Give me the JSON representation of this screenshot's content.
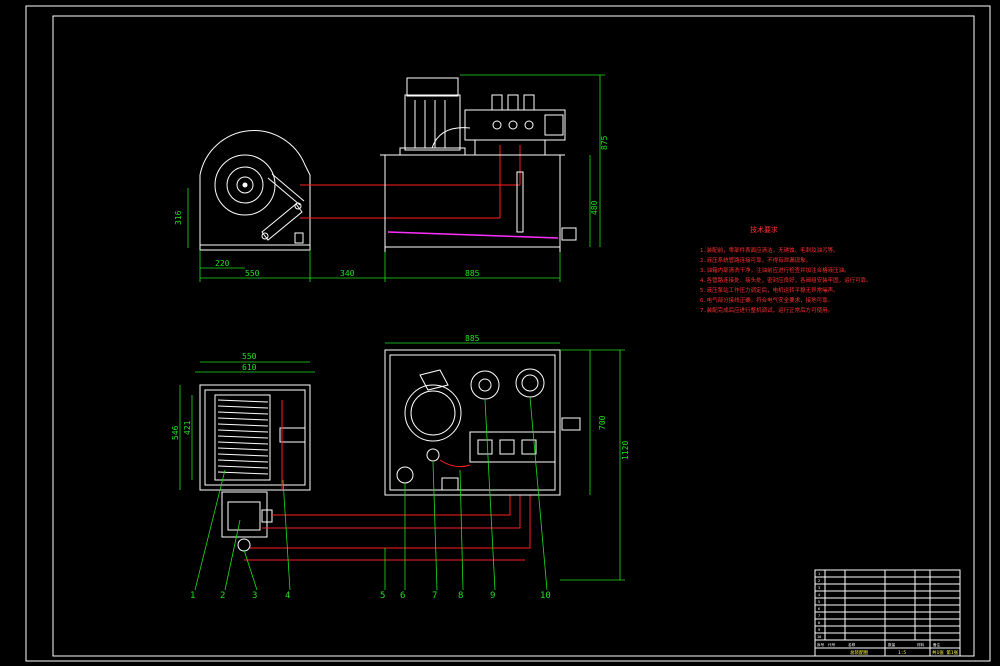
{
  "technical_requirements": {
    "title": "技术要求",
    "lines": [
      "1.装配前，零部件表面应清洁，无锈蚀、毛刺及油污等。",
      "2.液压系统管路连接可靠，不得有泄漏现象。",
      "3.油箱内部清洗干净，注油前应进行检查并加注合格液压油。",
      "4.各管路连接处、接头处，密封应良好，各阀组安装牢固，运行可靠。",
      "5.液压泵站工作压力调定后，电机运转平稳无异常噪声。",
      "6.电气部分接线正确，符合电气安全要求，接地可靠。",
      "7.装配完成后应进行整机调试，运行正常后方可使用。"
    ]
  },
  "dimensions": {
    "side_view": {
      "height_left": "316",
      "offset_bottom": "220",
      "length_drum": "550",
      "spacing": "340",
      "tank_length": "885",
      "total_height": "875",
      "tank_height": "480"
    },
    "plan_view": {
      "top_width_outer": "550",
      "top_width_inner": "610",
      "height_outer": "546",
      "height_inner": "421",
      "tank_width": "885",
      "tank_depth": "700",
      "overall_depth": "1120"
    }
  },
  "part_balloons": [
    "1",
    "2",
    "3",
    "4",
    "5",
    "6",
    "7",
    "8",
    "9",
    "10"
  ],
  "title_block": {
    "rows": [
      "1",
      "2",
      "3",
      "4",
      "5",
      "6",
      "7",
      "8",
      "9",
      "10"
    ],
    "header": [
      "序号",
      "代号",
      "名称",
      "数量",
      "材料",
      "备注"
    ],
    "drawing_name": "总装配图",
    "scale": "1:5",
    "sheet": "共1张 第1张"
  },
  "colors": {
    "background": "#000000",
    "outline": "#ffffff",
    "dimension": "#20e020",
    "pipe": "#ff2020",
    "oil_level": "#ff30ff"
  }
}
